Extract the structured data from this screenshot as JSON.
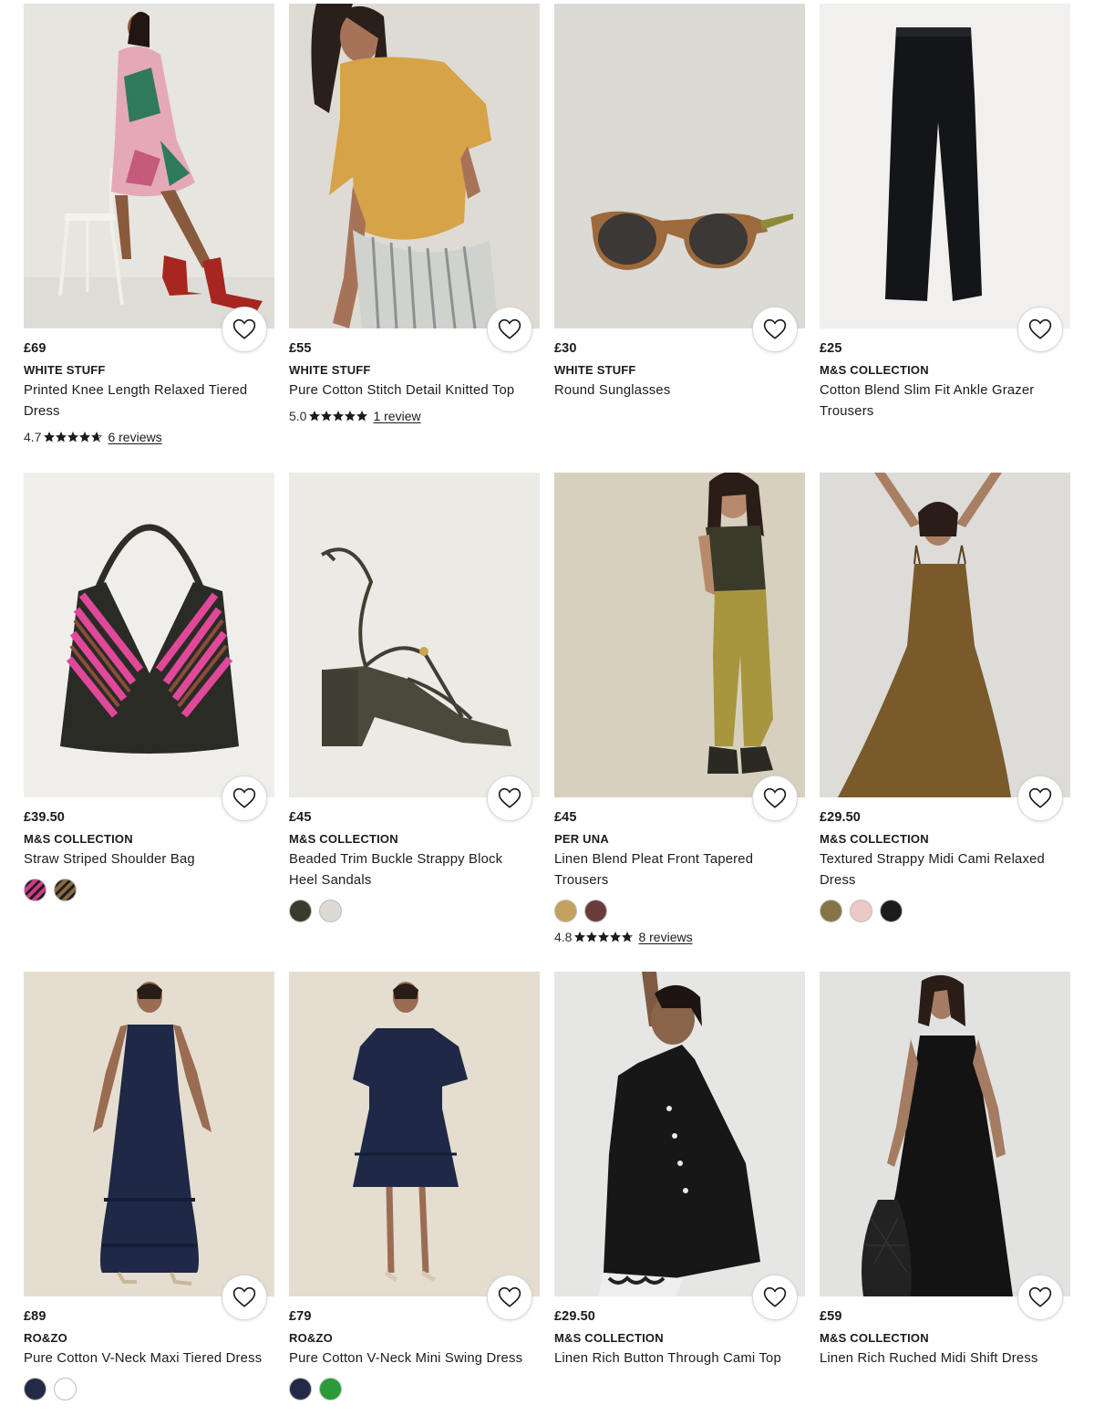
{
  "products": [
    {
      "price": "£69",
      "brand": "WHITE STUFF",
      "name": "Printed Knee Length Relaxed Tiered Dress",
      "rating": "4.7",
      "reviews": "6 reviews",
      "swatches": []
    },
    {
      "price": "£55",
      "brand": "WHITE STUFF",
      "name": "Pure Cotton Stitch Detail Knitted Top",
      "rating": "5.0",
      "reviews": "1 review",
      "swatches": []
    },
    {
      "price": "£30",
      "brand": "WHITE STUFF",
      "name": "Round Sunglasses",
      "swatches": []
    },
    {
      "price": "£25",
      "brand": "M&S COLLECTION",
      "name": "Cotton Blend Slim Fit Ankle Grazer Trousers",
      "swatches": []
    },
    {
      "price": "£39.50",
      "brand": "M&S COLLECTION",
      "name": "Straw Striped Shoulder Bag",
      "swatches": [
        "#d43a8c",
        "#8a6a42"
      ]
    },
    {
      "price": "£45",
      "brand": "M&S COLLECTION",
      "name": "Beaded Trim Buckle Strappy Block Heel Sandals",
      "swatches": [
        "#3a3a2e",
        "#dcdad2"
      ]
    },
    {
      "price": "£45",
      "brand": "PER UNA",
      "name": "Linen Blend Pleat Front Tapered Trousers",
      "rating": "4.8",
      "reviews": "8 reviews",
      "swatches": [
        "#c4a15e",
        "#6b3b3b"
      ]
    },
    {
      "price": "£29.50",
      "brand": "M&S COLLECTION",
      "name": "Textured Strappy Midi Cami Relaxed Dress",
      "swatches": [
        "#857445",
        "#ecc9c6",
        "#1c1c1a"
      ]
    },
    {
      "price": "£89",
      "brand": "RO&ZO",
      "name": "Pure Cotton V-Neck Maxi Tiered Dress",
      "swatches": [
        "#232a48",
        "#ffffff"
      ]
    },
    {
      "price": "£79",
      "brand": "RO&ZO",
      "name": "Pure Cotton V-Neck Mini Swing Dress",
      "swatches": [
        "#232a48",
        "#2b9b3a"
      ]
    },
    {
      "price": "£29.50",
      "brand": "M&S COLLECTION",
      "name": "Linen Rich Button Through Cami Top",
      "swatches": []
    },
    {
      "price": "£59",
      "brand": "M&S COLLECTION",
      "name": "Linen Rich Ruched Midi Shift Dress",
      "swatches": []
    }
  ],
  "icons": {
    "wishlist": "heart-outline-icon",
    "star": "star-icon"
  }
}
